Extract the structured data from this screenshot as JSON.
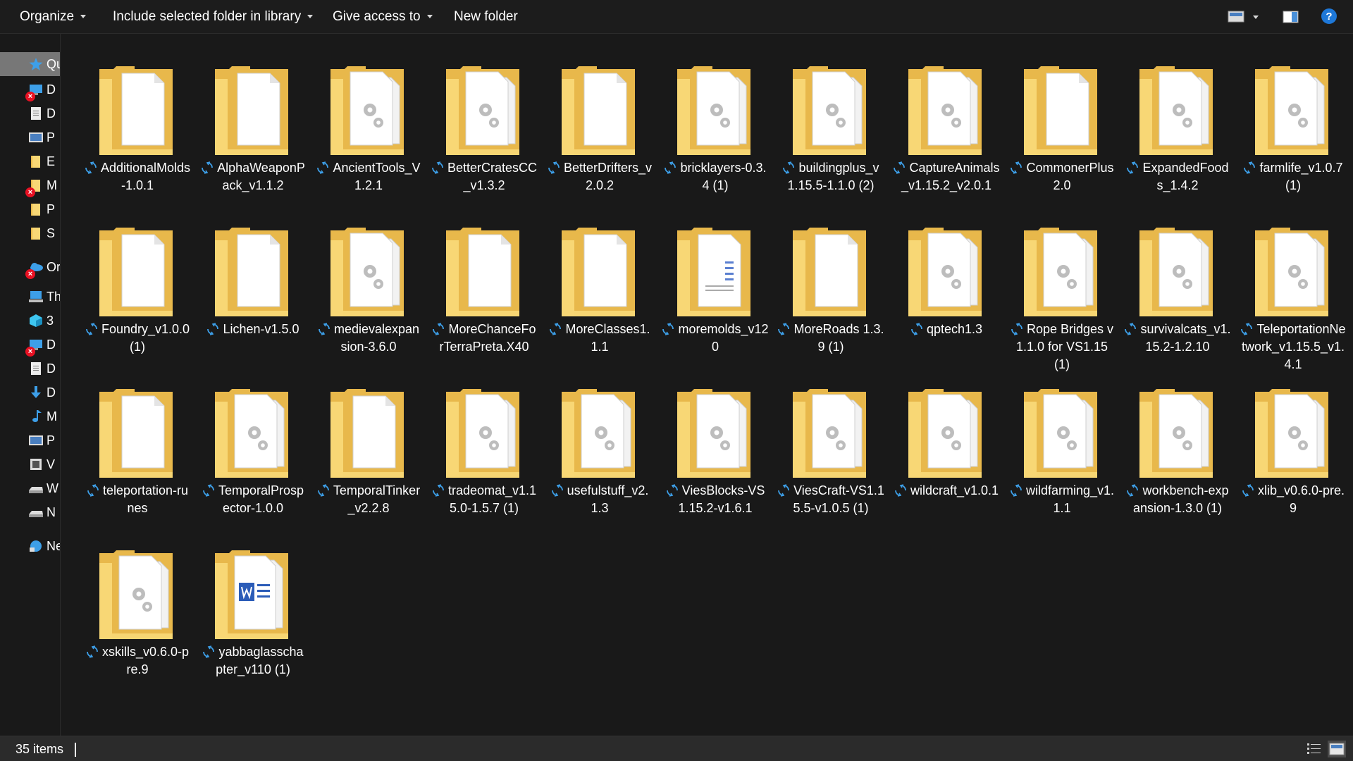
{
  "toolbar": {
    "organize": "Organize",
    "include": "Include selected folder in library",
    "give_access": "Give access to",
    "new_folder": "New folder"
  },
  "nav": {
    "items": [
      {
        "label": "Qu",
        "icon": "star-icon",
        "selected": true,
        "error": false
      },
      {
        "label": "D",
        "icon": "desktop-icon",
        "selected": false,
        "error": true
      },
      {
        "label": "D",
        "icon": "document-icon",
        "selected": false,
        "error": false
      },
      {
        "label": "P",
        "icon": "picture-icon",
        "selected": false,
        "error": false
      },
      {
        "label": "E",
        "icon": "folder-icon",
        "selected": false,
        "error": false
      },
      {
        "label": "M",
        "icon": "folder-icon",
        "selected": false,
        "error": true
      },
      {
        "label": "P",
        "icon": "folder-icon",
        "selected": false,
        "error": false
      },
      {
        "label": "S",
        "icon": "folder-icon",
        "selected": false,
        "error": false
      },
      {
        "label": "Or",
        "icon": "onedrive-icon",
        "selected": false,
        "error": true
      },
      {
        "label": "Th",
        "icon": "computer-icon",
        "selected": false,
        "error": false
      },
      {
        "label": "3",
        "icon": "cube-3d-icon",
        "selected": false,
        "error": false
      },
      {
        "label": "D",
        "icon": "desktop-icon",
        "selected": false,
        "error": true
      },
      {
        "label": "D",
        "icon": "document-icon",
        "selected": false,
        "error": false
      },
      {
        "label": "D",
        "icon": "download-icon",
        "selected": false,
        "error": false
      },
      {
        "label": "M",
        "icon": "music-icon",
        "selected": false,
        "error": false
      },
      {
        "label": "P",
        "icon": "picture-icon",
        "selected": false,
        "error": false
      },
      {
        "label": "V",
        "icon": "video-icon",
        "selected": false,
        "error": false
      },
      {
        "label": "W",
        "icon": "drive-icon",
        "selected": false,
        "error": false
      },
      {
        "label": "N",
        "icon": "drive-icon",
        "selected": false,
        "error": false
      },
      {
        "label": "Ne",
        "icon": "network-icon",
        "selected": false,
        "error": false
      }
    ]
  },
  "folders": [
    {
      "name": "AdditionalMolds-1.0.1",
      "thumb": "files"
    },
    {
      "name": "AlphaWeaponPack_v1.1.2",
      "thumb": "files"
    },
    {
      "name": "AncientTools_V1.2.1",
      "thumb": "gear"
    },
    {
      "name": "BetterCratesCC_v1.3.2",
      "thumb": "gear"
    },
    {
      "name": "BetterDrifters_v2.0.2",
      "thumb": "files"
    },
    {
      "name": "bricklayers-0.3.4 (1)",
      "thumb": "gear"
    },
    {
      "name": "buildingplus_v1.15.5-1.1.0 (2)",
      "thumb": "gear"
    },
    {
      "name": "CaptureAnimals_v1.15.2_v2.0.1",
      "thumb": "gear"
    },
    {
      "name": "CommonerPlus2.0",
      "thumb": "files"
    },
    {
      "name": "ExpandedFoods_1.4.2",
      "thumb": "gear"
    },
    {
      "name": "farmlife_v1.0.7 (1)",
      "thumb": "gear"
    },
    {
      "name": "Foundry_v1.0.0 (1)",
      "thumb": "files"
    },
    {
      "name": "Lichen-v1.5.0",
      "thumb": "files"
    },
    {
      "name": "medievalexpansion-3.6.0",
      "thumb": "gear"
    },
    {
      "name": "MoreChanceForTerraPreta.X40",
      "thumb": "files"
    },
    {
      "name": "MoreClasses1.1.1",
      "thumb": "files"
    },
    {
      "name": "moremolds_v120",
      "thumb": "doc"
    },
    {
      "name": "MoreRoads 1.3.9 (1)",
      "thumb": "files"
    },
    {
      "name": "qptech1.3",
      "thumb": "gear"
    },
    {
      "name": "Rope Bridges v1.1.0 for VS1.15 (1)",
      "thumb": "gear"
    },
    {
      "name": "survivalcats_v1.15.2-1.2.10",
      "thumb": "gear"
    },
    {
      "name": "TeleportationNetwork_v1.15.5_v1.4.1",
      "thumb": "gear"
    },
    {
      "name": "teleportation-runes",
      "thumb": "files"
    },
    {
      "name": "TemporalProspector-1.0.0",
      "thumb": "gear"
    },
    {
      "name": "TemporalTinker_v2.2.8",
      "thumb": "files"
    },
    {
      "name": "tradeomat_v1.15.0-1.5.7 (1)",
      "thumb": "gear"
    },
    {
      "name": "usefulstuff_v2.1.3",
      "thumb": "gear"
    },
    {
      "name": "ViesBlocks-VS1.15.2-v1.6.1",
      "thumb": "gear"
    },
    {
      "name": "ViesCraft-VS1.15.5-v1.0.5 (1)",
      "thumb": "gear"
    },
    {
      "name": "wildcraft_v1.0.1",
      "thumb": "gear"
    },
    {
      "name": "wildfarming_v1.1.1",
      "thumb": "gear"
    },
    {
      "name": "workbench-expansion-1.3.0 (1)",
      "thumb": "gear"
    },
    {
      "name": "xlib_v0.6.0-pre.9",
      "thumb": "gear"
    },
    {
      "name": "xskills_v0.6.0-pre.9",
      "thumb": "gear"
    },
    {
      "name": "yabbaglasschapter_v110 (1)",
      "thumb": "word"
    }
  ],
  "status": {
    "item_count": "35 items"
  },
  "colors": {
    "folder": "#f8d775",
    "folder_dark": "#e8b84b",
    "sync_blue": "#3d9fe8",
    "error_red": "#e81123",
    "selected_nav": "#777777"
  }
}
